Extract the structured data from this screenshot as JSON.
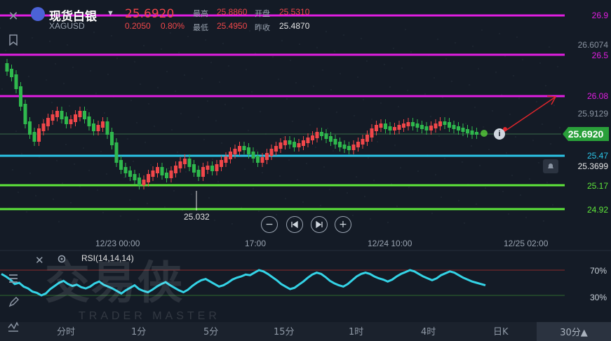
{
  "header": {
    "title": "现货白银",
    "code": "XAGUSD",
    "price": "25.6920",
    "change": "0.2050",
    "change_pct": "0.80%",
    "high_label": "最高",
    "high_value": "25.8860",
    "open_label": "开盘",
    "open_value": "25.5310",
    "low_label": "最低",
    "low_value": "25.4950",
    "prev_close_label": "昨收",
    "prev_close_value": "25.4870"
  },
  "price_axis": {
    "level_1": "26.9",
    "level_2": "26.6074",
    "level_3": "26.5",
    "level_4": "26.08",
    "level_5": "25.9129",
    "current": "25.6920",
    "level_6": "25.47",
    "level_7": "25.3699",
    "level_8": "25.17",
    "level_9": "24.92"
  },
  "low_marker": "25.032",
  "time_axis": [
    "12/23 00:00",
    "17:00",
    "12/24 10:00",
    "12/25 02:00"
  ],
  "rsi": {
    "label": "RSI(14,14,14)",
    "upper": "70%",
    "lower": "30%",
    "values": [
      64,
      60,
      55,
      48,
      50,
      44,
      41,
      36,
      34,
      30,
      33,
      40,
      45,
      50,
      53,
      48,
      45,
      47,
      43,
      41,
      44,
      49,
      52,
      47,
      44,
      41,
      37,
      33,
      38,
      42,
      46,
      40,
      37,
      35,
      39,
      44,
      48,
      51,
      46,
      42,
      38,
      35,
      39,
      45,
      50,
      54,
      56,
      52,
      48,
      44,
      46,
      50,
      55,
      58,
      60,
      63,
      62,
      66,
      70,
      68,
      64,
      59,
      54,
      48,
      44,
      40,
      42,
      47,
      52,
      58,
      63,
      66,
      64,
      59,
      53,
      49,
      46,
      44,
      48,
      54,
      60,
      64,
      66,
      64,
      60,
      57,
      55,
      52,
      55,
      60,
      64,
      67,
      70,
      68,
      64,
      60,
      57,
      54,
      57,
      62,
      65,
      68,
      66,
      62,
      58,
      55,
      52,
      50,
      48,
      46
    ],
    "color": "#34d3e6"
  },
  "timeframes": [
    "分时",
    "1分",
    "5分",
    "15分",
    "1时",
    "4时",
    "日K"
  ],
  "active_timeframe": "30分▲",
  "watermark": "交易侠",
  "watermark_sub": "TRADER MASTER",
  "colors": {
    "up": "#f0474a",
    "down": "#2fb84d",
    "magenta": "#e01ee0",
    "cyan": "#2bc4e6",
    "green_line": "#5ee63a",
    "background": "#141b26"
  },
  "icons": {
    "close": "close-icon",
    "bookmark": "bookmark-icon",
    "layers": "layers-icon",
    "tools": "chart-tools-icon",
    "pen": "pen-icon",
    "indicator": "indicator-icon",
    "zoom_out": "zoom-out-icon",
    "prev": "step-back-icon",
    "next": "step-forward-icon",
    "zoom_in": "zoom-in-icon",
    "bell": "bell-icon",
    "info": "info-icon",
    "settings": "settings-icon",
    "dropdown": "chevron-down-icon"
  }
}
